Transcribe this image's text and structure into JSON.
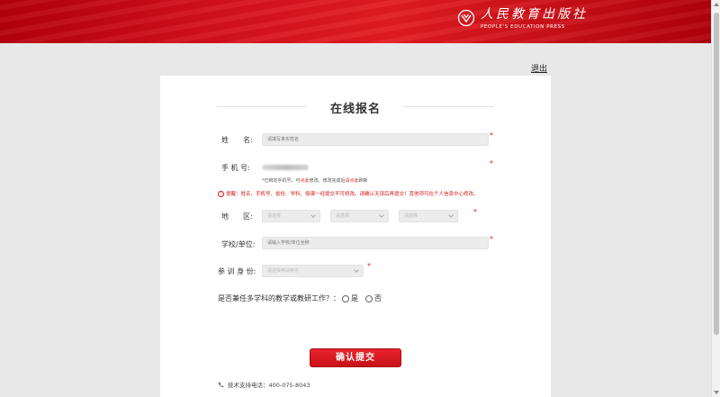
{
  "header": {
    "brand_cn": "人民教育出版社",
    "brand_en": "PEOPLE'S EDUCATION PRESS"
  },
  "top_links": {
    "logout": "退出"
  },
  "form": {
    "title": "在线报名",
    "name": {
      "label": "姓　　名:",
      "placeholder": "请填写真实姓名"
    },
    "phone": {
      "label": "手 机 号:",
      "hint_prefix": "*已绑定手机号，可",
      "hint_link1": "点此",
      "hint_mid": "修改。修改完成后",
      "hint_link2": "请点此",
      "hint_suffix": "刷新"
    },
    "warning": "提醒：姓名、手机号、省份、学科、授课一经提交不可修改。请确认无误后再提交！其他项可在个人信息中心修改。",
    "region": {
      "label": "地　　区:",
      "province": "请选择",
      "city": "请选择",
      "district": "请选择"
    },
    "school": {
      "label": "学校/单位:",
      "placeholder": "请输入学校/单位全称"
    },
    "identity": {
      "label": "参 训 身 份:",
      "placeholder": "请选择参训身份"
    },
    "multi_subject": {
      "question": "是否兼任多学科的教学或教研工作？：",
      "yes": "是",
      "no": "否"
    },
    "required_mark": "*",
    "submit": "确认提交"
  },
  "footer": {
    "support": "技术支持电话：400-075-8043"
  },
  "colors": {
    "brand_red": "#d4101c",
    "required": "#e02020"
  }
}
